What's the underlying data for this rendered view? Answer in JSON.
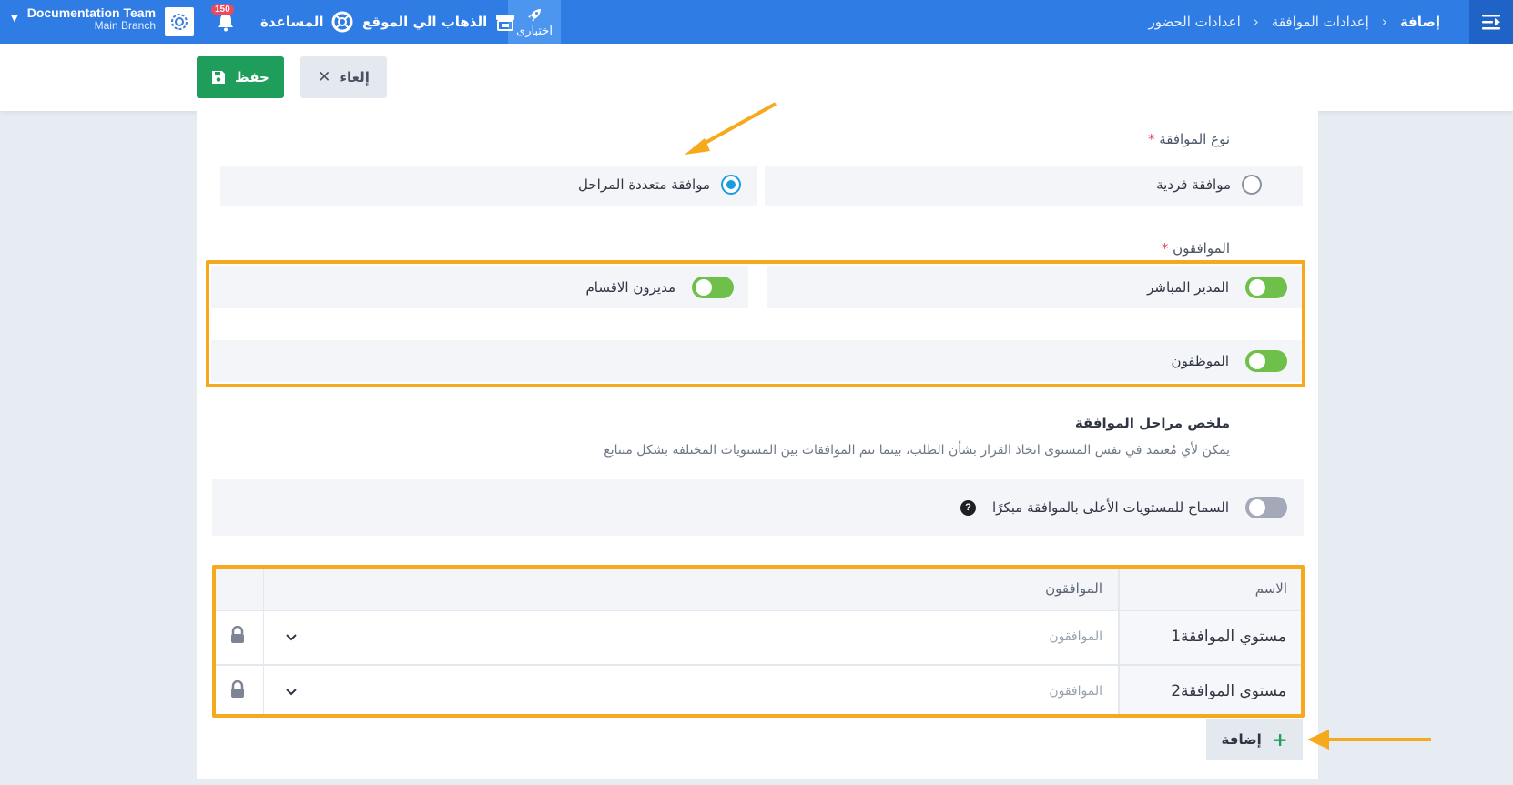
{
  "topbar": {
    "breadcrumbs": [
      "اعدادات الحضور",
      "إعدادات الموافقة",
      "إضافة"
    ],
    "trial_label": "اختبارى",
    "go_to_site_label": "الذهاب الي الموقع",
    "help_label": "المساعدة",
    "notification_count": "150",
    "user_name": "Documentation Team",
    "branch": "Main Branch"
  },
  "actions": {
    "save_label": "حفظ",
    "cancel_label": "إلغاء"
  },
  "approval_type": {
    "label": "نوع الموافقة",
    "required_mark": "*",
    "options": [
      {
        "label": "موافقة فردية",
        "selected": false
      },
      {
        "label": "موافقة متعددة المراحل",
        "selected": true
      }
    ]
  },
  "approvers": {
    "label": "الموافقون",
    "required_mark": "*",
    "toggles": [
      {
        "label": "المدير المباشر",
        "on": true
      },
      {
        "label": "مديرون الاقسام",
        "on": true
      },
      {
        "label": "الموظفون",
        "on": true
      }
    ]
  },
  "summary": {
    "title": "ملخص مراحل الموافقة",
    "description": "يمكن لأي مُعتمد في نفس المستوى اتخاذ القرار بشأن الطلب، بينما تتم الموافقات بين المستويات المختلفة بشكل متتابع",
    "early_approval_label": "السماح للمستويات الأعلى بالموافقة مبكرًا",
    "early_approval_on": false
  },
  "levels_table": {
    "headers": {
      "name": "الاسم",
      "approvers": "الموافقون"
    },
    "rows": [
      {
        "name": "مستوي الموافقة1",
        "approvers_placeholder": "الموافقون"
      },
      {
        "name": "مستوي الموافقة2",
        "approvers_placeholder": "الموافقون"
      }
    ],
    "add_label": "إضافة"
  },
  "colors": {
    "primary": "#2f7ce4",
    "save": "#1e9e5a",
    "toggle_on": "#6fc04b",
    "highlight": "#f6a91d",
    "radio": "#1a9de0"
  }
}
